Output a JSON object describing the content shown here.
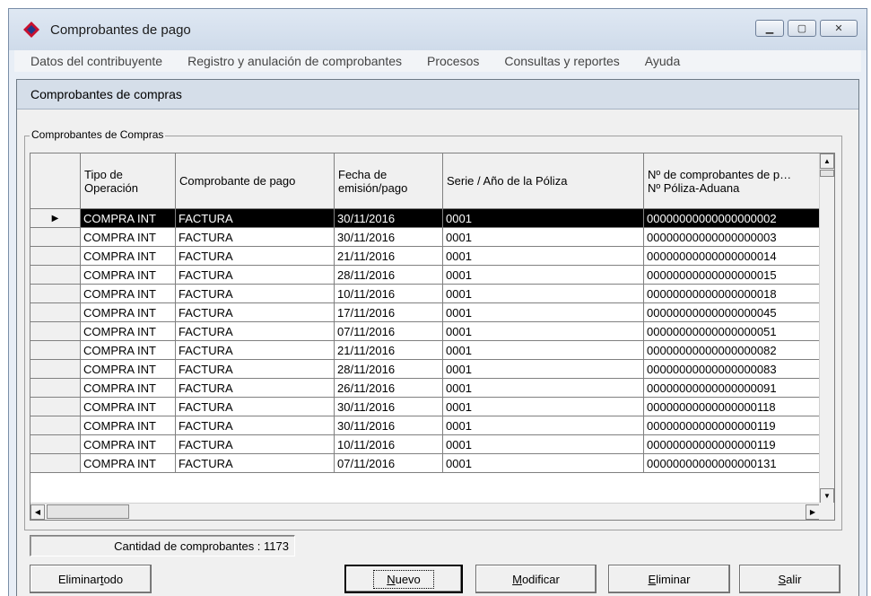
{
  "window": {
    "title": "Comprobantes de pago"
  },
  "menu": [
    "Datos del contribuyente",
    "Registro y anulación de comprobantes",
    "Procesos",
    "Consultas y reportes",
    "Ayuda"
  ],
  "form": {
    "title": "Comprobantes de compras",
    "group_label": "Comprobantes de Compras"
  },
  "grid": {
    "columns": [
      "",
      "Tipo de Operación",
      "Comprobante de pago",
      "Fecha de emisión/pago",
      "Serie / Año de la Póliza",
      "Nº de comprobantes de p… Nº Póliza-Aduana"
    ],
    "column_lines": [
      [
        "Tipo de",
        "Operación"
      ],
      [
        "Comprobante de pago"
      ],
      [
        "Fecha de",
        "emisión/pago"
      ],
      [
        "Serie / Año de la Póliza"
      ],
      [
        "Nº de comprobantes de p…",
        "Nº Póliza-Aduana"
      ]
    ],
    "rows": [
      [
        "COMPRA INT",
        "FACTURA",
        "30/11/2016",
        "0001",
        "00000000000000000002"
      ],
      [
        "COMPRA INT",
        "FACTURA",
        "30/11/2016",
        "0001",
        "00000000000000000003"
      ],
      [
        "COMPRA INT",
        "FACTURA",
        "21/11/2016",
        "0001",
        "00000000000000000014"
      ],
      [
        "COMPRA INT",
        "FACTURA",
        "28/11/2016",
        "0001",
        "00000000000000000015"
      ],
      [
        "COMPRA INT",
        "FACTURA",
        "10/11/2016",
        "0001",
        "00000000000000000018"
      ],
      [
        "COMPRA INT",
        "FACTURA",
        "17/11/2016",
        "0001",
        "00000000000000000045"
      ],
      [
        "COMPRA INT",
        "FACTURA",
        "07/11/2016",
        "0001",
        "00000000000000000051"
      ],
      [
        "COMPRA INT",
        "FACTURA",
        "21/11/2016",
        "0001",
        "00000000000000000082"
      ],
      [
        "COMPRA INT",
        "FACTURA",
        "28/11/2016",
        "0001",
        "00000000000000000083"
      ],
      [
        "COMPRA INT",
        "FACTURA",
        "26/11/2016",
        "0001",
        "00000000000000000091"
      ],
      [
        "COMPRA INT",
        "FACTURA",
        "30/11/2016",
        "0001",
        "00000000000000000118"
      ],
      [
        "COMPRA INT",
        "FACTURA",
        "30/11/2016",
        "0001",
        "00000000000000000119"
      ],
      [
        "COMPRA INT",
        "FACTURA",
        "10/11/2016",
        "0001",
        "00000000000000000119"
      ],
      [
        "COMPRA INT",
        "FACTURA",
        "07/11/2016",
        "0001",
        "00000000000000000131"
      ]
    ],
    "selected_row": 0
  },
  "status": {
    "count_text": "Cantidad de comprobantes : 1173"
  },
  "buttons": {
    "eliminar_todo": {
      "pre": "Eliminar ",
      "u": "t",
      "post": "odo"
    },
    "nuevo": {
      "pre": "",
      "u": "N",
      "post": "uevo"
    },
    "modificar": {
      "pre": "",
      "u": "M",
      "post": "odificar"
    },
    "eliminar": {
      "pre": "",
      "u": "E",
      "post": "liminar"
    },
    "salir": {
      "pre": "",
      "u": "S",
      "post": "alir"
    }
  },
  "icons": {
    "app": "red-diamond-logo-icon",
    "row_pointer": "triangle-right-icon"
  },
  "colors": {
    "title_bg": "#d5dee9",
    "selected_row_bg": "#000000",
    "selected_row_fg": "#ffffff"
  }
}
